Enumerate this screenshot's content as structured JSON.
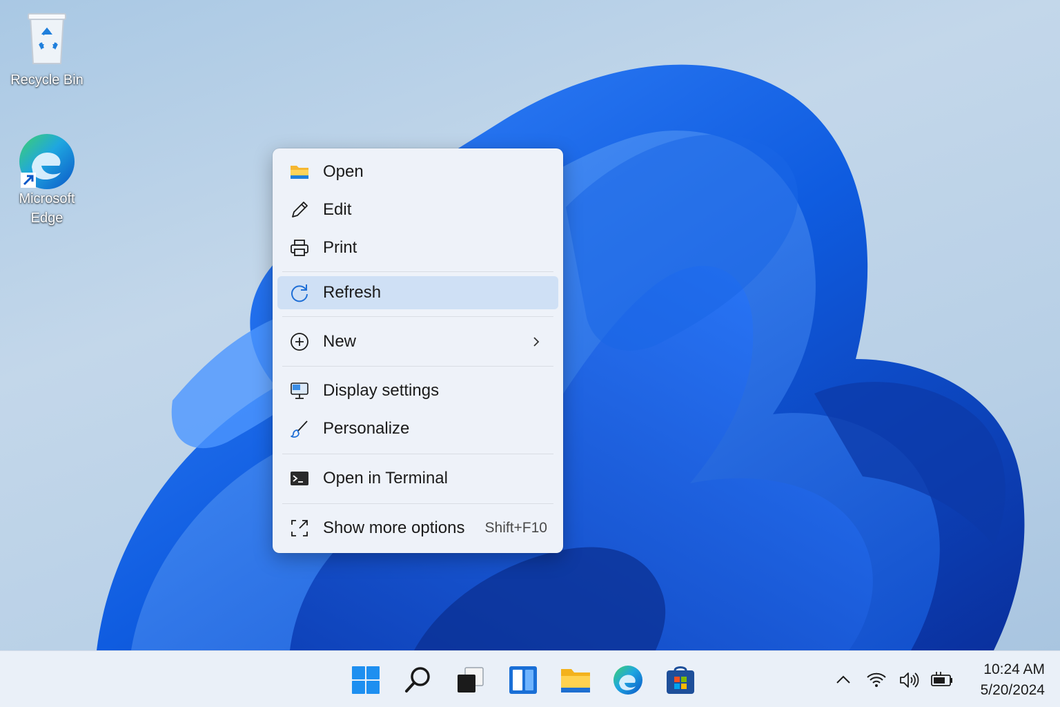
{
  "desktop": {
    "icons": [
      {
        "label": "Recycle Bin",
        "icon": "recycle-bin-icon"
      },
      {
        "label": "Microsoft Edge",
        "icon": "edge-icon"
      }
    ]
  },
  "context_menu": {
    "items": [
      {
        "label": "Open",
        "icon": "folder-icon"
      },
      {
        "label": "Edit",
        "icon": "pencil-icon"
      },
      {
        "label": "Print",
        "icon": "printer-icon"
      },
      {
        "label": "Refresh",
        "icon": "refresh-icon",
        "highlighted": true
      },
      {
        "label": "New",
        "icon": "plus-circle-icon",
        "submenu": true
      },
      {
        "label": "Display settings",
        "icon": "monitor-icon"
      },
      {
        "label": "Personalize",
        "icon": "brush-icon"
      },
      {
        "label": "Open in Terminal",
        "icon": "terminal-icon"
      },
      {
        "label": "Show more options",
        "icon": "expand-icon",
        "shortcut": "Shift+F10"
      }
    ]
  },
  "taskbar": {
    "apps": [
      {
        "name": "Start",
        "icon": "windows-start-icon"
      },
      {
        "name": "Search",
        "icon": "search-icon"
      },
      {
        "name": "Task View",
        "icon": "task-view-icon"
      },
      {
        "name": "Widgets",
        "icon": "widgets-icon"
      },
      {
        "name": "File Explorer",
        "icon": "file-explorer-icon"
      },
      {
        "name": "Microsoft Edge",
        "icon": "edge-icon"
      },
      {
        "name": "Microsoft Store",
        "icon": "store-icon"
      }
    ],
    "tray": [
      "chevron-up-icon",
      "wifi-icon",
      "volume-icon",
      "battery-icon"
    ],
    "time": "10:24 AM",
    "date": "5/20/2024"
  },
  "colors": {
    "accent": "#0a5fd6",
    "menu_background": "#eef2f9",
    "menu_highlight": "#cfe0f5"
  }
}
